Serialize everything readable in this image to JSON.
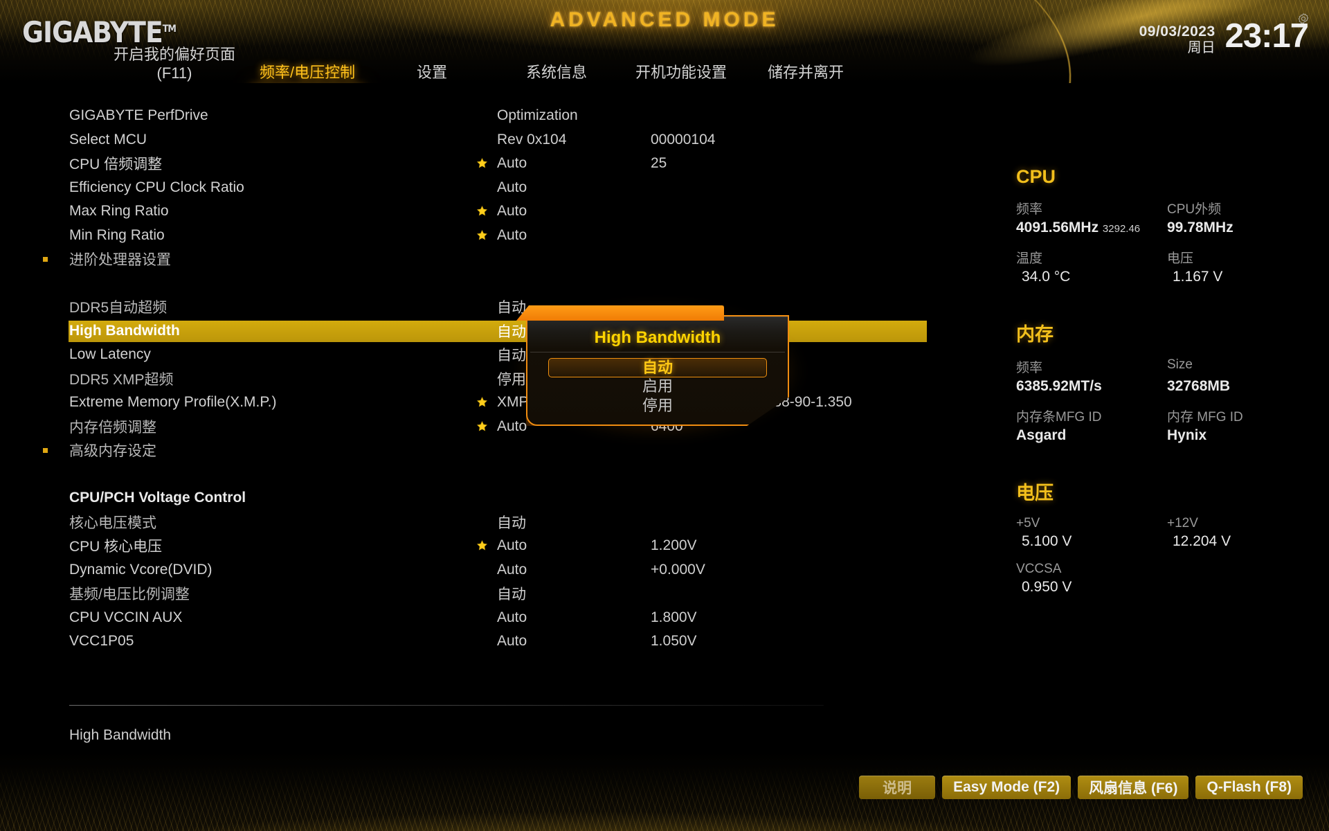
{
  "header": {
    "brand": "GIGABYTE",
    "brand_tm": "TM",
    "mode_title": "ADVANCED MODE",
    "date": "09/03/2023",
    "weekday": "周日",
    "time": "23:17"
  },
  "nav": {
    "favorites_line1": "开启我的偏好页面",
    "favorites_line2": "(F11)",
    "items": [
      {
        "label": "频率/电压控制",
        "active": true
      },
      {
        "label": "设置",
        "active": false
      },
      {
        "label": "系统信息",
        "active": false
      },
      {
        "label": "开机功能设置",
        "active": false
      },
      {
        "label": "储存并离开",
        "active": false
      }
    ]
  },
  "settings": [
    {
      "name": "GIGABYTE PerfDrive",
      "value": "Optimization",
      "value2": "",
      "star": false,
      "bullet": false,
      "cjk": false,
      "header": false,
      "selected": false
    },
    {
      "name": "Select MCU",
      "value": "Rev 0x104",
      "value2": "00000104",
      "star": false,
      "bullet": false,
      "cjk": false,
      "header": false,
      "selected": false
    },
    {
      "name": "CPU 倍频调整",
      "value": "Auto",
      "value2": "25",
      "star": true,
      "bullet": false,
      "cjk": false,
      "header": false,
      "selected": false
    },
    {
      "name": "Efficiency CPU Clock Ratio",
      "value": "Auto",
      "value2": "",
      "star": false,
      "bullet": false,
      "cjk": false,
      "header": false,
      "selected": false
    },
    {
      "name": "Max Ring Ratio",
      "value": "Auto",
      "value2": "",
      "star": true,
      "bullet": false,
      "cjk": false,
      "header": false,
      "selected": false
    },
    {
      "name": "Min Ring Ratio",
      "value": "Auto",
      "value2": "",
      "star": true,
      "bullet": false,
      "cjk": false,
      "header": false,
      "selected": false
    },
    {
      "name": "进阶处理器设置",
      "value": "",
      "value2": "",
      "star": false,
      "bullet": true,
      "cjk": true,
      "header": false,
      "selected": false
    },
    {
      "name": "",
      "value": "",
      "value2": "",
      "star": false,
      "bullet": false,
      "cjk": false,
      "header": false,
      "selected": false,
      "spacer": true
    },
    {
      "name": "DDR5自动超频",
      "value": "自动",
      "value2": "",
      "star": false,
      "bullet": false,
      "cjk": true,
      "header": false,
      "selected": false
    },
    {
      "name": "High Bandwidth",
      "value": "自动",
      "value2": "",
      "star": false,
      "bullet": false,
      "cjk": false,
      "header": false,
      "selected": true
    },
    {
      "name": "Low Latency",
      "value": "自动",
      "value2": "",
      "star": false,
      "bullet": false,
      "cjk": false,
      "header": false,
      "selected": false
    },
    {
      "name": "DDR5 XMP超频",
      "value": "停用",
      "value2": "",
      "star": false,
      "bullet": false,
      "cjk": true,
      "header": false,
      "selected": false
    },
    {
      "name": "Extreme Memory Profile(X.M.P.)",
      "value": "XMP 1",
      "value2": "DDR5-6400 32-38-38-90-1.350",
      "star": true,
      "bullet": false,
      "cjk": false,
      "header": false,
      "selected": false
    },
    {
      "name": "内存倍频调整",
      "value": "Auto",
      "value2": "6400",
      "star": true,
      "bullet": false,
      "cjk": true,
      "header": false,
      "selected": false
    },
    {
      "name": "高级内存设定",
      "value": "",
      "value2": "",
      "star": false,
      "bullet": true,
      "cjk": true,
      "header": false,
      "selected": false
    },
    {
      "name": "",
      "value": "",
      "value2": "",
      "star": false,
      "bullet": false,
      "cjk": false,
      "header": false,
      "selected": false,
      "spacer": true
    },
    {
      "name": "CPU/PCH Voltage Control",
      "value": "",
      "value2": "",
      "star": false,
      "bullet": false,
      "cjk": false,
      "header": true,
      "selected": false
    },
    {
      "name": "核心电压模式",
      "value": "自动",
      "value2": "",
      "star": false,
      "bullet": false,
      "cjk": true,
      "header": false,
      "selected": false
    },
    {
      "name": "CPU 核心电压",
      "value": "Auto",
      "value2": "1.200V",
      "star": true,
      "bullet": false,
      "cjk": false,
      "header": false,
      "selected": false
    },
    {
      "name": "Dynamic Vcore(DVID)",
      "value": "Auto",
      "value2": "+0.000V",
      "star": false,
      "bullet": false,
      "cjk": false,
      "header": false,
      "selected": false
    },
    {
      "name": "基频/电压比例调整",
      "value": "自动",
      "value2": "",
      "star": false,
      "bullet": false,
      "cjk": true,
      "header": false,
      "selected": false
    },
    {
      "name": "CPU VCCIN AUX",
      "value": "Auto",
      "value2": "1.800V",
      "star": false,
      "bullet": false,
      "cjk": false,
      "header": false,
      "selected": false
    },
    {
      "name": "VCC1P05",
      "value": "Auto",
      "value2": "1.050V",
      "star": false,
      "bullet": false,
      "cjk": false,
      "header": false,
      "selected": false
    }
  ],
  "popup": {
    "title": "High Bandwidth",
    "options": [
      {
        "label": "自动",
        "selected": true
      },
      {
        "label": "启用",
        "selected": false
      },
      {
        "label": "停用",
        "selected": false
      }
    ]
  },
  "sidebar": {
    "cpu": {
      "title": "CPU",
      "freq_label": "频率",
      "freq_value": "4091.56MHz",
      "freq_sub": "3292.46",
      "bclk_label": "CPU外频",
      "bclk_value": "99.78MHz",
      "temp_label": "温度",
      "temp_value": "34.0 °C",
      "volt_label": "电压",
      "volt_value": "1.167 V"
    },
    "memory": {
      "title": "内存",
      "freq_label": "频率",
      "freq_value": "6385.92MT/s",
      "size_label": "Size",
      "size_value": "32768MB",
      "module_mfg_label": "内存条MFG ID",
      "module_mfg_value": "Asgard",
      "dram_mfg_label": "内存 MFG ID",
      "dram_mfg_value": "Hynix"
    },
    "voltage": {
      "title": "电压",
      "v5_label": "+5V",
      "v5_value": "5.100 V",
      "v12_label": "+12V",
      "v12_value": "12.204 V",
      "vccsa_label": "VCCSA",
      "vccsa_value": "0.950 V"
    }
  },
  "help": {
    "text": "High Bandwidth"
  },
  "footer": {
    "keys": [
      {
        "label": "说明",
        "dim": true
      },
      {
        "label": "Easy Mode (F2)",
        "dim": false
      },
      {
        "label": "风扇信息 (F6)",
        "dim": false
      },
      {
        "label": "Q-Flash (F8)",
        "dim": false
      }
    ]
  },
  "colors": {
    "accent": "#f0b323",
    "highlight": "#d3ab0d",
    "popup_border": "#f08c10",
    "selected_text": "#ffc814"
  }
}
